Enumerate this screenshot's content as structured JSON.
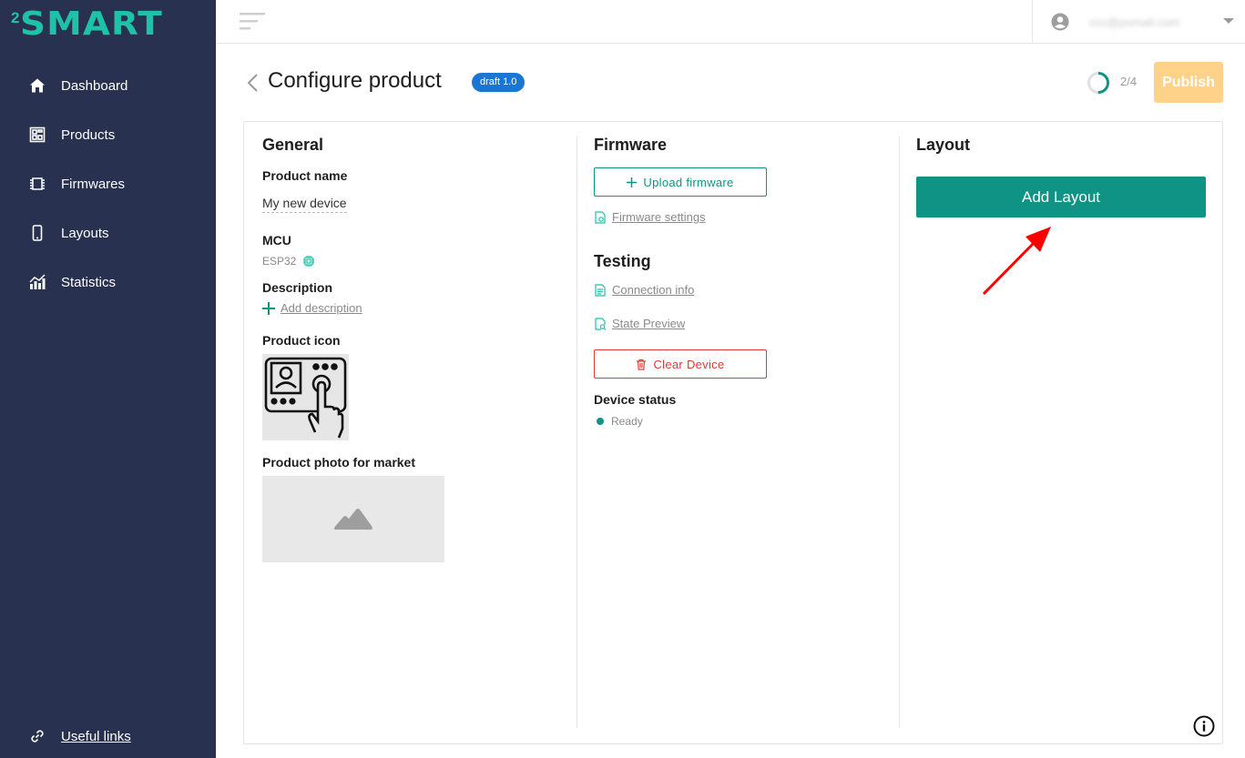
{
  "sidebar": {
    "logo_sup": "2",
    "logo_word": "SMART",
    "items": [
      {
        "label": "Dashboard",
        "icon": "home-icon"
      },
      {
        "label": "Products",
        "icon": "products-icon"
      },
      {
        "label": "Firmwares",
        "icon": "chip-icon"
      },
      {
        "label": "Layouts",
        "icon": "phone-icon"
      },
      {
        "label": "Statistics",
        "icon": "chart-icon"
      }
    ],
    "useful_links": "Useful links"
  },
  "topbar": {
    "user_email": "ccc@pomail.com"
  },
  "header": {
    "title": "Configure product",
    "badge": "draft 1.0",
    "progress": "2/4",
    "progress_fraction": 0.5,
    "publish_label": "Publish"
  },
  "general": {
    "title": "General",
    "product_name_label": "Product name",
    "product_name_value": "My new device",
    "mcu_label": "MCU",
    "mcu_value": "ESP32",
    "description_label": "Description",
    "add_description": "Add description",
    "product_icon_label": "Product icon",
    "product_photo_label": "Product photo for market"
  },
  "firmware": {
    "title": "Firmware",
    "upload_label": "Upload firmware",
    "settings_label": "Firmware settings"
  },
  "testing": {
    "title": "Testing",
    "connection_info": "Connection info",
    "state_preview": "State Preview",
    "clear_device": "Clear Device",
    "device_status_label": "Device status",
    "device_status_value": "Ready"
  },
  "layout": {
    "title": "Layout",
    "add_layout": "Add Layout"
  },
  "colors": {
    "sidebar_bg": "#283250",
    "accent": "#0f9384",
    "logo": "#1fc2a7",
    "danger": "#e53935",
    "badge": "#1976d2",
    "publish": "#ffd28a"
  }
}
